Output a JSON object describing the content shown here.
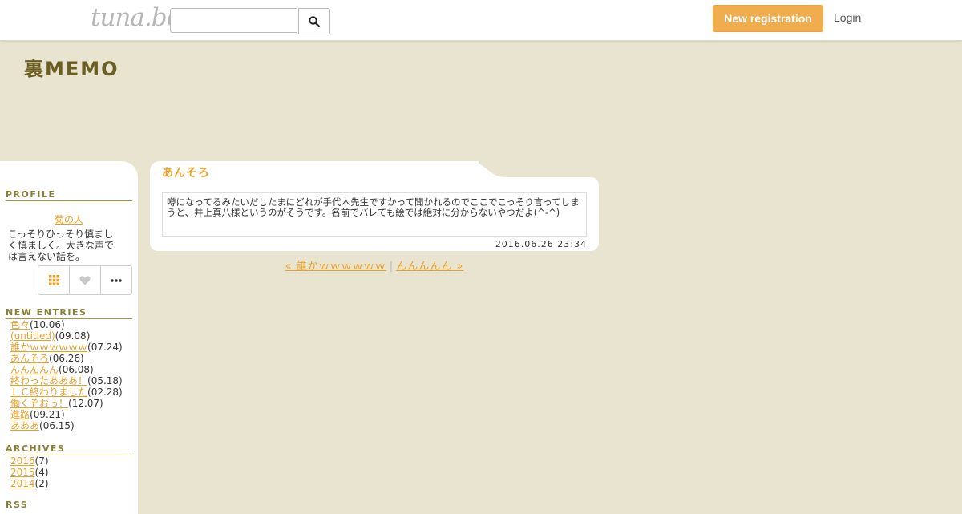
{
  "header": {
    "logo": "tuna.be",
    "search_placeholder": "",
    "register_label": "New registration",
    "login_label": "Login"
  },
  "blog": {
    "title": "裏MEMO"
  },
  "sidebar": {
    "profile_heading": "PROFILE",
    "profile_name": "菊の人",
    "profile_desc": "こっそりひっそり慎ましく慎ましく。大きな声では言えない話を。",
    "entries_heading": "NEW ENTRIES",
    "entries": [
      {
        "title": "色々",
        "date": "(10.06)"
      },
      {
        "title": "(untitled)",
        "date": "(09.08)"
      },
      {
        "title": "誰かｗｗｗｗｗｗ",
        "date": "(07.24)"
      },
      {
        "title": "あんそろ",
        "date": "(06.26)"
      },
      {
        "title": "んんんんん",
        "date": "(06.08)"
      },
      {
        "title": "終わったあああ！",
        "date": "(05.18)"
      },
      {
        "title": "ＬＣ終わりました",
        "date": "(02.28)"
      },
      {
        "title": "働くぞおっ！",
        "date": "(12.07)"
      },
      {
        "title": "進路",
        "date": "(09.21)"
      },
      {
        "title": "あああ",
        "date": "(06.15)"
      }
    ],
    "archives_heading": "ARCHIVES",
    "archives": [
      {
        "year": "2016",
        "count": "(7)"
      },
      {
        "year": "2015",
        "count": "(4)"
      },
      {
        "year": "2014",
        "count": "(2)"
      }
    ],
    "rss_heading": "RSS"
  },
  "article": {
    "title": "あんそろ",
    "body": "噂になってるみたいだしたまにどれが手代木先生ですかって聞かれるのでここでこっそり言ってしまうと、井上真八様というのがそうです。名前でバレても絵では絶対に分からないやつだよ(^-^)",
    "date": "2016.06.26 23:34"
  },
  "pager": {
    "prev": "« 誰かｗｗｗｗｗｗ",
    "separator": "|",
    "next": "んんんんん »"
  },
  "colors": {
    "background": "#e8e4d0",
    "accent": "#f0ad4e",
    "link": "#e8a02c",
    "title": "#6b5e22",
    "heading": "#8c8038"
  }
}
